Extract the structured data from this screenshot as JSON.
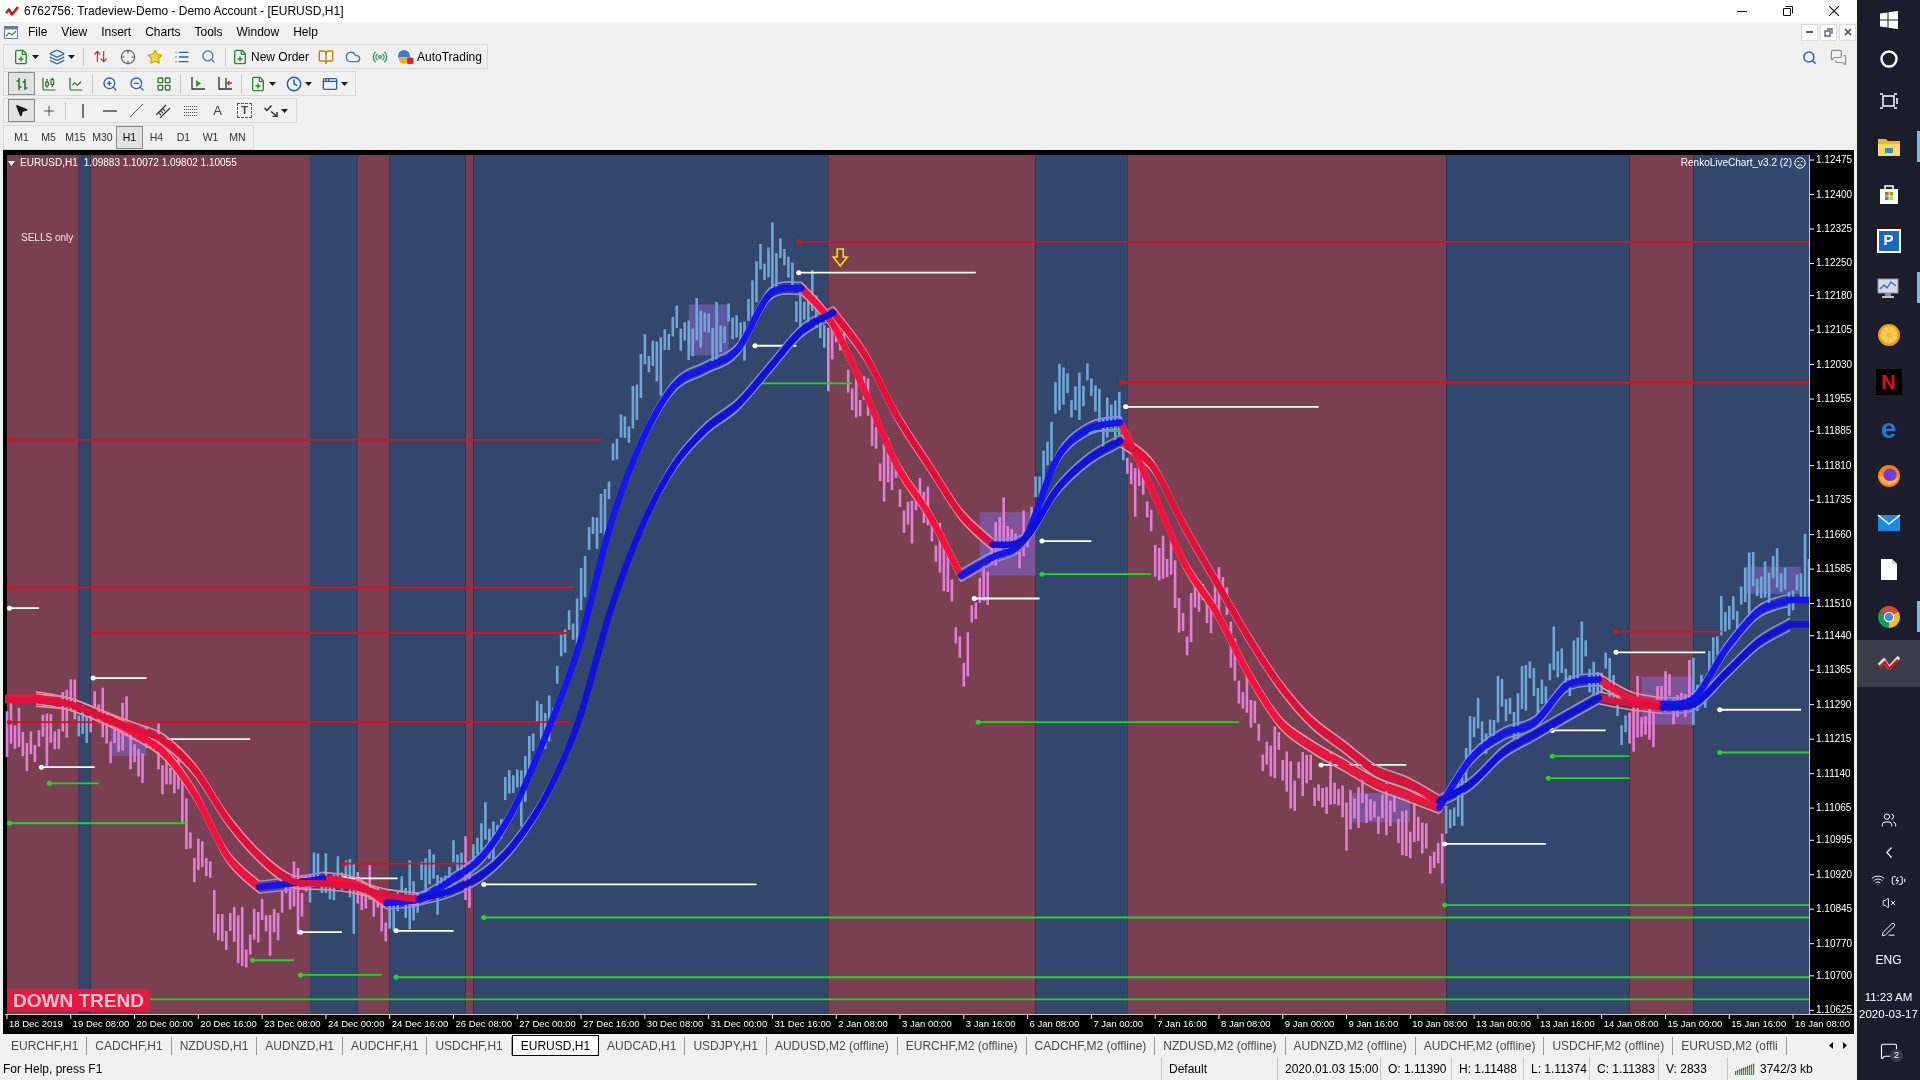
{
  "window": {
    "title": "6762756: Tradeview-Demo - Demo Account - [EURUSD,H1]"
  },
  "menu": [
    "File",
    "View",
    "Insert",
    "Charts",
    "Tools",
    "Window",
    "Help"
  ],
  "toolbar": {
    "new_order": "New Order",
    "auto_trading": {
      "label": "AutoTrading",
      "on": false
    },
    "chart_types": [
      {
        "kind": "bars",
        "selected": true
      },
      {
        "kind": "candles",
        "selected": false
      },
      {
        "kind": "line",
        "selected": false
      }
    ],
    "drawing_tools": [
      {
        "kind": "cursor",
        "selected": true
      },
      {
        "kind": "crosshair",
        "selected": false
      },
      {
        "kind": "vertical_line",
        "selected": false
      },
      {
        "kind": "horizontal_line",
        "selected": false
      },
      {
        "kind": "trendline",
        "selected": false
      },
      {
        "kind": "channel",
        "selected": false
      },
      {
        "kind": "fibonacci",
        "selected": false
      },
      {
        "kind": "text",
        "label": "A",
        "selected": false
      },
      {
        "kind": "text_label",
        "label": "T",
        "selected": false
      },
      {
        "kind": "arrows",
        "selected": false
      }
    ]
  },
  "timeframes": [
    {
      "label": "M1",
      "selected": false
    },
    {
      "label": "M5",
      "selected": false
    },
    {
      "label": "M15",
      "selected": false
    },
    {
      "label": "M30",
      "selected": false
    },
    {
      "label": "H1",
      "selected": true
    },
    {
      "label": "H4",
      "selected": false
    },
    {
      "label": "D1",
      "selected": false
    },
    {
      "label": "W1",
      "selected": false
    },
    {
      "label": "MN",
      "selected": false
    }
  ],
  "chart": {
    "ohlc": "1.09883 1.10072 1.09802 1.10055",
    "signal": "SELLS only",
    "indicator": "RenkoLiveChart_v3.2 (2)",
    "trend_label": "DOWN TREND",
    "chart_data": {
      "type": "line",
      "title": "EURUSD,H1",
      "categories": [
        "18 Dec 2019",
        null,
        "19 Dec 08:00",
        null,
        "20 Dec 00:00",
        null,
        "20 Dec 16:00",
        null,
        "23 Dec 08:00",
        null,
        "24 Dec 00:00",
        null,
        "24 Dec 16:00",
        null,
        "26 Dec 08:00",
        null,
        "27 Dec 00:00",
        null,
        "27 Dec 16:00",
        null,
        "30 Dec 08:00",
        null,
        "31 Dec 00:00",
        null,
        "31 Dec 16:00",
        null,
        "2 Jan 08:00",
        null,
        "3 Jan 00:00",
        null,
        "3 Jan 16:00",
        null,
        "6 Jan 08:00",
        null,
        "7 Jan 00:00",
        null,
        "7 Jan 16:00",
        null,
        "8 Jan 08:00",
        null,
        "9 Jan 00:00",
        null,
        "9 Jan 16:00",
        null,
        "10 Jan 08:00",
        null,
        "13 Jan 00:00",
        null,
        "13 Jan 16:00",
        null,
        "14 Jan 08:00",
        null,
        "15 Jan 00:00",
        null,
        "15 Jan 16:00",
        null,
        "16 Jan 08:00"
      ],
      "ylim": [
        1.10617,
        1.12486
      ],
      "yticks": [
        {
          "value": 1.12475,
          "label": "1.12475"
        },
        {
          "value": 1.124,
          "label": "1.12400"
        },
        {
          "value": 1.12325,
          "label": "1.12325"
        },
        {
          "value": 1.1225,
          "label": "1.12250"
        },
        {
          "value": 1.1218,
          "label": "1.12180"
        },
        {
          "value": 1.12105,
          "label": "1.12105"
        },
        {
          "value": 1.1203,
          "label": "1.12030"
        },
        {
          "value": 1.11955,
          "label": "1.11955"
        },
        {
          "value": 1.11885,
          "label": "1.11885"
        },
        {
          "value": 1.1181,
          "label": "1.11810"
        },
        {
          "value": 1.11735,
          "label": "1.11735"
        },
        {
          "value": 1.1166,
          "label": "1.11660"
        },
        {
          "value": 1.11585,
          "label": "1.11585"
        },
        {
          "value": 1.1151,
          "label": "1.11510"
        },
        {
          "value": 1.1144,
          "label": "1.11440"
        },
        {
          "value": 1.11365,
          "label": "1.11365"
        },
        {
          "value": 1.1129,
          "label": "1.11290"
        },
        {
          "value": 1.11215,
          "label": "1.11215"
        },
        {
          "value": 1.1114,
          "label": "1.11140"
        },
        {
          "value": 1.11065,
          "label": "1.11065"
        },
        {
          "value": 1.10995,
          "label": "1.10995"
        },
        {
          "value": 1.1092,
          "label": "1.10920"
        },
        {
          "value": 1.10845,
          "label": "1.10845"
        },
        {
          "value": 1.1077,
          "label": "1.10770"
        },
        {
          "value": 1.107,
          "label": "1.10700"
        },
        {
          "value": 1.10625,
          "label": "1.10625"
        }
      ],
      "series": [
        {
          "color": "#f2123c",
          "values": [
            1.11305,
            1.11292,
            1.11266,
            1.11231,
            1.11186,
            1.11093,
            1.1096,
            1.10893,
            null,
            1.10912,
            1.10901,
            1.10859,
            null,
            null,
            null,
            null,
            null,
            null,
            null,
            null,
            null,
            null,
            null,
            null,
            1.12196,
            1.12116,
            1.1197,
            1.1181,
            1.11704,
            1.11571,
            null,
            null,
            null,
            null,
            1.11904,
            1.11757,
            1.11598,
            1.11492,
            1.11359,
            1.11252,
            1.11199,
            1.11159,
            1.11119,
            1.11093,
            1.11066,
            null,
            null,
            null,
            null,
            1.11345,
            1.11305,
            1.11292,
            null,
            null,
            null,
            null,
            null
          ]
        },
        {
          "color": "#1414f0",
          "values": [
            null,
            null,
            null,
            null,
            null,
            null,
            null,
            1.10893,
            1.10901,
            1.10912,
            null,
            1.10859,
            1.10867,
            1.10907,
            1.1096,
            1.11066,
            1.11226,
            1.11412,
            1.11678,
            1.11864,
            1.11983,
            1.12023,
            1.12063,
            1.12183,
            1.12196,
            null,
            null,
            null,
            null,
            1.11571,
            1.11611,
            1.11651,
            1.11824,
            1.1189,
            1.11904,
            null,
            null,
            null,
            null,
            null,
            null,
            null,
            null,
            null,
            1.11066,
            1.11173,
            1.11226,
            1.11252,
            1.11332,
            1.11345,
            null,
            1.11292,
            1.11305,
            1.11412,
            1.11492,
            1.11518,
            null
          ]
        },
        {
          "color": "#e01038",
          "values": [
            1.113,
            1.11292,
            1.11266,
            1.11239,
            1.11212,
            1.11146,
            1.1104,
            1.1096,
            1.10907,
            1.10901,
            1.10893,
            1.10875,
            1.10867,
            null,
            null,
            null,
            null,
            null,
            null,
            null,
            null,
            null,
            null,
            null,
            null,
            1.12143,
            1.1205,
            1.11917,
            1.1181,
            1.11704,
            1.11638,
            null,
            null,
            null,
            1.11864,
            1.1181,
            1.11678,
            1.11558,
            1.11438,
            1.11332,
            1.11252,
            1.11199,
            1.11146,
            1.11119,
            1.1108,
            null,
            null,
            null,
            null,
            1.11305,
            1.11292,
            1.11284,
            null,
            null,
            null,
            null,
            null
          ]
        },
        {
          "color": "#1010d8",
          "values": [
            null,
            null,
            null,
            null,
            null,
            null,
            null,
            null,
            null,
            null,
            null,
            null,
            1.10867,
            1.10885,
            1.1092,
            1.10987,
            1.11093,
            1.11252,
            1.11492,
            1.11678,
            1.1181,
            1.1189,
            1.11943,
            1.12023,
            1.12103,
            1.12143,
            null,
            null,
            null,
            null,
            1.11638,
            1.11651,
            1.11757,
            1.11824,
            1.11864,
            null,
            null,
            null,
            null,
            null,
            null,
            null,
            null,
            null,
            1.1108,
            1.11119,
            1.11186,
            1.11226,
            1.11266,
            1.11305,
            null,
            1.11284,
            1.11292,
            1.11359,
            1.11425,
            1.11465,
            null
          ]
        }
      ]
    }
  },
  "tabs": [
    {
      "label": "EURCHF,H1",
      "selected": false
    },
    {
      "label": "CADCHF,H1",
      "selected": false
    },
    {
      "label": "NZDUSD,H1",
      "selected": false
    },
    {
      "label": "AUDNZD,H1",
      "selected": false
    },
    {
      "label": "AUDCHF,H1",
      "selected": false
    },
    {
      "label": "USDCHF,H1",
      "selected": false
    },
    {
      "label": "EURUSD,H1",
      "selected": true
    },
    {
      "label": "AUDCAD,H1",
      "selected": false
    },
    {
      "label": "USDJPY,H1",
      "selected": false
    },
    {
      "label": "AUDUSD,M2 (offline)",
      "selected": false
    },
    {
      "label": "EURCHF,M2 (offline)",
      "selected": false
    },
    {
      "label": "CADCHF,M2 (offline)",
      "selected": false
    },
    {
      "label": "NZDUSD,M2 (offline)",
      "selected": false
    },
    {
      "label": "AUDNZD,M2 (offline)",
      "selected": false
    },
    {
      "label": "AUDCHF,M2 (offline)",
      "selected": false
    },
    {
      "label": "USDCHF,M2 (offline)",
      "selected": false
    },
    {
      "label": "EURUSD,M2 (offli",
      "selected": false
    }
  ],
  "status_bar": {
    "help": "For Help, press F1",
    "profile": "Default",
    "time": "2020.01.03 15:00",
    "open": "O: 1.11390",
    "high": "H: 1.11488",
    "low": "L: 1.11374",
    "close": "C: 1.11383",
    "volume": "V: 2833",
    "traffic": "3742/3 kb"
  },
  "taskbar": {
    "apps": [
      {
        "kind": "folder",
        "selected": false,
        "running": true
      },
      {
        "kind": "bag",
        "selected": false,
        "running": false
      },
      {
        "kind": "tile",
        "glyph": "P",
        "selected": false,
        "running": false
      },
      {
        "kind": "monitor",
        "selected": false,
        "running": true
      },
      {
        "kind": "citrus",
        "selected": false,
        "running": false
      },
      {
        "kind": "dark_tile",
        "glyph": "N",
        "selected": false,
        "running": false
      },
      {
        "kind": "letter",
        "glyph": "e",
        "selected": false,
        "running": false
      },
      {
        "kind": "globe",
        "selected": false,
        "running": false
      },
      {
        "kind": "mail",
        "selected": false,
        "running": false
      },
      {
        "kind": "document",
        "selected": false,
        "running": false
      },
      {
        "kind": "segmented_circle",
        "selected": false,
        "running": true
      },
      {
        "kind": "swoosh",
        "selected": true,
        "running": false
      }
    ],
    "language": "ENG",
    "time": "11:23 AM",
    "date": "2020-03-17",
    "notifications": "2"
  }
}
